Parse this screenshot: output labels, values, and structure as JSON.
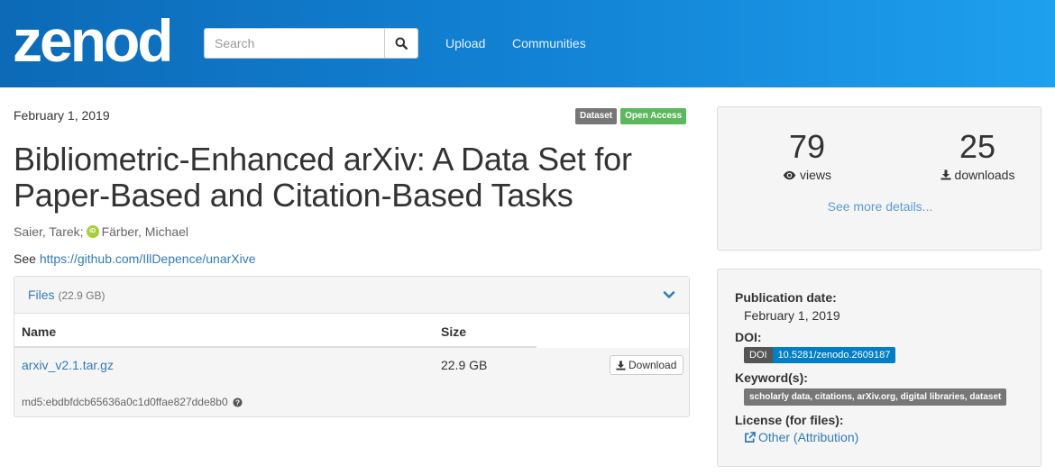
{
  "header": {
    "logo_text": "zenodo",
    "search": {
      "placeholder": "Search"
    },
    "nav": {
      "upload": "Upload",
      "communities": "Communities"
    }
  },
  "record": {
    "publication_date": "February 1, 2019",
    "badges": {
      "type": "Dataset",
      "access": "Open Access"
    },
    "title": "Bibliometric-Enhanced arXiv: A Data Set for Paper-Based and Citation-Based Tasks",
    "authors": {
      "first": "Saier, Tarek;",
      "second": "Färber, Michael"
    },
    "description": {
      "prefix": "See",
      "link": "https://github.com/IllDepence/unarXive"
    }
  },
  "files": {
    "title": "Files",
    "total_size": "(22.9 GB)",
    "columns": {
      "name": "Name",
      "size": "Size"
    },
    "rows": [
      {
        "name": "arxiv_v2.1.tar.gz",
        "size": "22.9 GB",
        "action": "Download",
        "md5": "md5:ebdbfdcb65636a0c1d0ffae827dde8b0"
      }
    ]
  },
  "stats": {
    "views": {
      "value": "79",
      "label": "views"
    },
    "downloads": {
      "value": "25",
      "label": "downloads"
    },
    "see_more": "See more details..."
  },
  "info": {
    "publication_date_label": "Publication date:",
    "publication_date": "February 1, 2019",
    "doi_label": "DOI:",
    "doi_prefix": "DOI",
    "doi": "10.5281/zenodo.2609187",
    "keywords_label": "Keyword(s):",
    "keywords": "scholarly data, citations, arXiv.org, digital libraries, dataset",
    "license_label": "License (for files):",
    "license": "Other (Attribution)"
  },
  "colors": {
    "header_start": "#0c6ab7",
    "header_end": "#1ea0ef",
    "link": "#337ab7",
    "open_access": "#5cb85c",
    "doi_blue": "#007ec6"
  }
}
